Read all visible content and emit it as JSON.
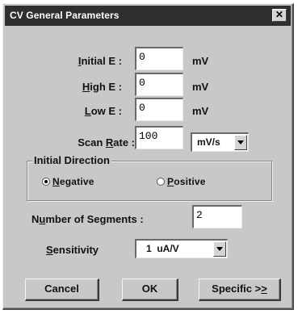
{
  "window": {
    "title": "CV General Parameters",
    "close_glyph": "✕"
  },
  "params": {
    "initial_e": {
      "label_pre": "",
      "label_acc": "I",
      "label_post": "nitial E :",
      "value": "0",
      "unit": "mV"
    },
    "high_e": {
      "label_pre": "",
      "label_acc": "H",
      "label_post": "igh E :",
      "value": "0",
      "unit": "mV"
    },
    "low_e": {
      "label_pre": "",
      "label_acc": "L",
      "label_post": "ow E :",
      "value": "0",
      "unit": "mV"
    },
    "scan_rate": {
      "label_pre": "Scan ",
      "label_acc": "R",
      "label_post": "ate :",
      "value": "100",
      "unit_selected": "mV/s"
    }
  },
  "direction": {
    "group_title": "Initial Direction",
    "negative": {
      "acc": "N",
      "rest": "egative",
      "checked": true
    },
    "positive": {
      "acc": "P",
      "rest": "ositive",
      "checked": false
    }
  },
  "segments": {
    "label_pre": "N",
    "label_acc": "u",
    "label_post": "mber of Segments :",
    "value": "2"
  },
  "sensitivity": {
    "label_acc": "S",
    "label_post": "ensitivity",
    "selected": "1  uA/V"
  },
  "buttons": {
    "cancel": "Cancel",
    "ok": "OK",
    "specific_pre": "Specific >",
    "specific_acc": ">"
  },
  "icons": {
    "close": "close-icon",
    "dropdown": "chevron-down-icon",
    "radio": "radio-icon"
  }
}
